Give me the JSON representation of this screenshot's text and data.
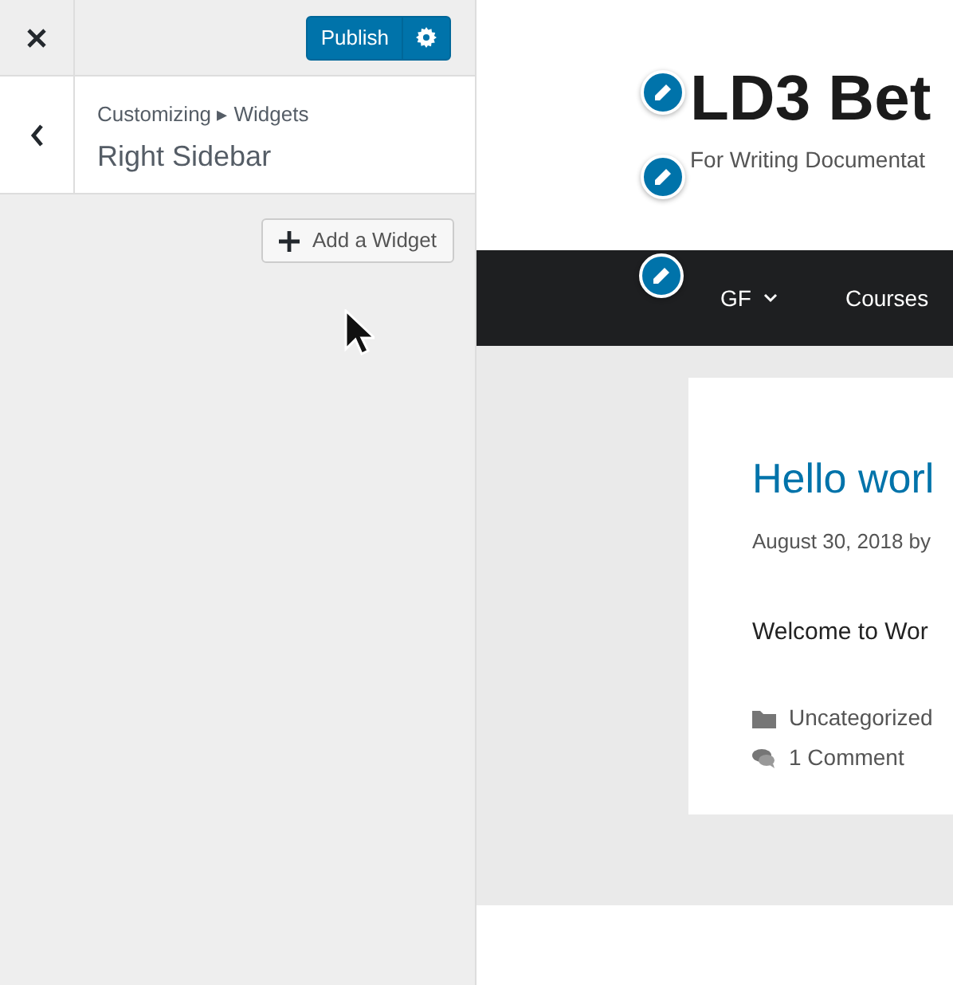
{
  "customizer": {
    "publish_button": "Publish",
    "breadcrumb": "Customizing ▸ Widgets",
    "section_title": "Right Sidebar",
    "add_widget_button": "Add a Widget"
  },
  "preview": {
    "site_title": "LD3 Bet",
    "tagline": "For Writing Documentat",
    "nav_items": [
      {
        "label": "GF",
        "has_dropdown": true
      },
      {
        "label": "Courses",
        "has_dropdown": false
      }
    ],
    "post": {
      "title": "Hello worl",
      "meta": "August 30, 2018 by",
      "excerpt": "Welcome to Wor",
      "category": "Uncategorized",
      "comments": "1 Comment"
    }
  }
}
